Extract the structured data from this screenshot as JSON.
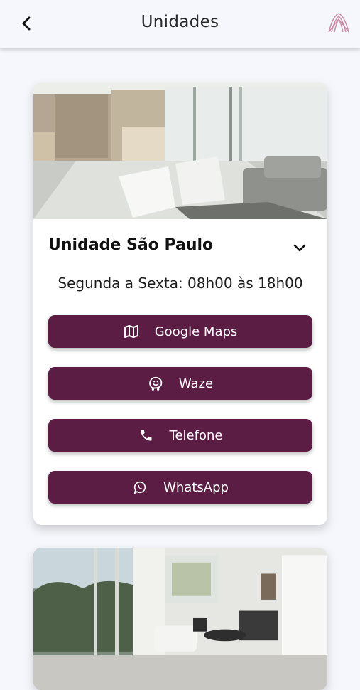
{
  "header": {
    "title": "Unidades"
  },
  "units": [
    {
      "name": "Unidade São Paulo",
      "hours": "Segunda a Sexta: 08h00 às 18h00",
      "buttons": {
        "maps": "Google Maps",
        "waze": "Waze",
        "phone": "Telefone",
        "whatsapp": "WhatsApp"
      }
    }
  ],
  "colors": {
    "accent": "#5c1d45",
    "background": "#f6f7fc",
    "logo": "#c98aa4"
  }
}
